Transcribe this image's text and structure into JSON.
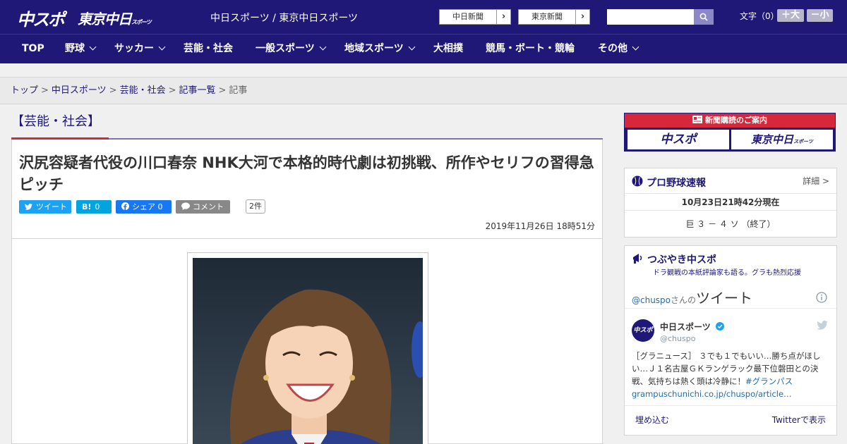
{
  "header": {
    "logo_primary": "中スポ",
    "logo_secondary": "東京中日",
    "logo_secondary_suffix": "スポーツ",
    "site_names": "中日スポーツ / 東京中日スポーツ",
    "paper_links": [
      "中日新聞",
      "東京新聞"
    ],
    "font_size_label": "文字（0）",
    "font_bigger": "＋大",
    "font_smaller": "－小",
    "search_placeholder": ""
  },
  "nav": {
    "items": [
      {
        "label": "TOP"
      },
      {
        "label": "野球"
      },
      {
        "label": "サッカー"
      },
      {
        "label": "芸能・社会"
      },
      {
        "label": "一般スポーツ"
      },
      {
        "label": "地域スポーツ"
      },
      {
        "label": "大相撲"
      },
      {
        "label": "競馬・ボート・競輪"
      },
      {
        "label": "その他"
      }
    ]
  },
  "breadcrumb": [
    "トップ",
    "中日スポーツ",
    "芸能・社会",
    "記事一覧",
    "記事"
  ],
  "section_title": "【芸能・社会】",
  "article": {
    "headline": "沢尻容疑者代役の川口春奈 NHK大河で本格的時代劇は初挑戦、所作やセリフの習得急ピッチ",
    "share": {
      "tweet": "ツイート",
      "hatena_icon": "B!",
      "hatena_count": "0",
      "facebook": "シェア 0",
      "comment": "コメント",
      "comment_count": "2件"
    },
    "datetime": "2019年11月26日 18時51分"
  },
  "sidebar": {
    "subscribe_title": "新聞購読のご案内",
    "subscribe_buttons": [
      "中スポ",
      "東京中日"
    ],
    "subscribe_suffix": "スポーツ",
    "baseball": {
      "title": "プロ野球速報",
      "details": "詳細 >",
      "timestamp": "10月23日21時42分現在",
      "score": "巨 ３ － ４ ソ （終了）"
    },
    "tweets": {
      "title": "つぶやき中スポ",
      "subtitle": "ドラ観戦の本紙評論家も語る。グラも熱烈応援",
      "handle_prefix": "@chuspo",
      "handle_suffix": "さんの",
      "tweet_word": "ツイート",
      "account_name": "中日スポーツ",
      "account_handle": "@chuspo",
      "avatar_text": "中スポ",
      "body": "［グラニュース］ ３でも１でもいい…勝ち点がほしい…Ｊ１名古屋ＧＫランゲラック最下位磐田との決戦、気持ちは熱く頭は冷静に！",
      "hashtag": "#グランパス",
      "link": "grampuschunichi.co.jp/chuspo/article…",
      "embed": "埋め込む",
      "view_on_twitter": "Twitterで表示"
    }
  },
  "colors": {
    "brand_navy": "#1f1877",
    "accent_red": "#d6283a",
    "twitter": "#1da1f2",
    "facebook": "#1877f2"
  }
}
